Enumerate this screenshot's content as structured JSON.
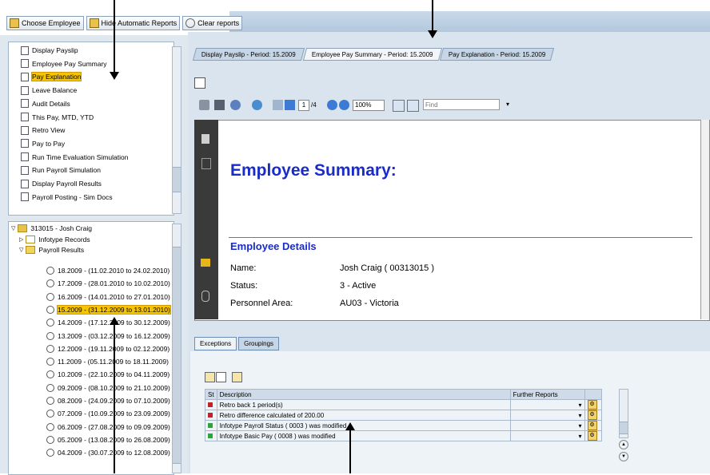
{
  "toolbar": {
    "choose_employee": "Choose Employee",
    "hide_automatic_reports": "Hide Automatic Reports",
    "clear_reports": "Clear reports"
  },
  "report_tree": {
    "items": [
      {
        "label": "Display Payslip"
      },
      {
        "label": "Employee Pay Summary"
      },
      {
        "label": "Pay Explanation",
        "selected": true
      },
      {
        "label": "Leave Balance"
      },
      {
        "label": "Audit Details"
      },
      {
        "label": "This Pay, MTD, YTD"
      },
      {
        "label": "Retro View"
      },
      {
        "label": "Pay to Pay"
      },
      {
        "label": "Run Time Evaluation Simulation"
      },
      {
        "label": "Run Payroll Simulation"
      },
      {
        "label": "Display Payroll Results"
      },
      {
        "label": "Payroll Posting - Sim Docs"
      }
    ]
  },
  "employee_tree": {
    "employee": "313015 - Josh Craig",
    "infotype_records": "Infotype Records",
    "payroll_results": "Payroll Results",
    "periods": [
      {
        "label": "18.2009 - (11.02.2010 to 24.02.2010)"
      },
      {
        "label": "17.2009 - (28.01.2010 to 10.02.2010)"
      },
      {
        "label": "16.2009 - (14.01.2010 to 27.01.2010)"
      },
      {
        "label": "15.2009 - (31.12.2009 to 13.01.2010)",
        "selected": true
      },
      {
        "label": "14.2009 - (17.12.2009 to 30.12.2009)"
      },
      {
        "label": "13.2009 - (03.12.2009 to 16.12.2009)"
      },
      {
        "label": "12.2009 - (19.11.2009 to 02.12.2009)"
      },
      {
        "label": "11.2009 - (05.11.2009 to 18.11.2009)"
      },
      {
        "label": "10.2009 - (22.10.2009 to 04.11.2009)"
      },
      {
        "label": "09.2009 - (08.10.2009 to 21.10.2009)"
      },
      {
        "label": "08.2009 - (24.09.2009 to 07.10.2009)"
      },
      {
        "label": "07.2009 - (10.09.2009 to 23.09.2009)"
      },
      {
        "label": "06.2009 - (27.08.2009 to 09.09.2009)"
      },
      {
        "label": "05.2009 - (13.08.2009 to 26.08.2009)"
      },
      {
        "label": "04.2009 - (30.07.2009 to 12.08.2009)"
      }
    ]
  },
  "tabs": [
    {
      "label": "Display Payslip - Period: 15.2009"
    },
    {
      "label": "Employee Pay Summary - Period: 15.2009",
      "active": true
    },
    {
      "label": "Pay Explanation - Period: 15.2009"
    }
  ],
  "viewer": {
    "page_current": "1",
    "page_total": "/4",
    "zoom": "100%",
    "find_placeholder": "Find",
    "title": "Employee Summary:",
    "section": "Employee Details",
    "fields": [
      {
        "label": "Name:",
        "value": "Josh Craig ( 00313015 )"
      },
      {
        "label": "Status:",
        "value": "3 - Active"
      },
      {
        "label": "Personnel Area:",
        "value": "AU03 - Victoria"
      }
    ]
  },
  "lower": {
    "tabs": [
      {
        "label": "Exceptions",
        "active": true
      },
      {
        "label": "Groupings"
      }
    ],
    "columns": {
      "st": "St",
      "description": "Description",
      "further": "Further Reports"
    },
    "rows": [
      {
        "status": "red",
        "description": "Retro back 1 period(s)"
      },
      {
        "status": "red",
        "description": "Retro difference calculated of 200.00"
      },
      {
        "status": "green",
        "description": "Infotype Payroll Status ( 0003 ) was modified"
      },
      {
        "status": "green",
        "description": "Infotype Basic Pay ( 0008 ) was modified"
      }
    ]
  },
  "colors": {
    "accent_blue": "#1a2cc8",
    "selection_yellow": "#f6c400",
    "status_red": "#c0222c",
    "status_green": "#2aa43c"
  }
}
